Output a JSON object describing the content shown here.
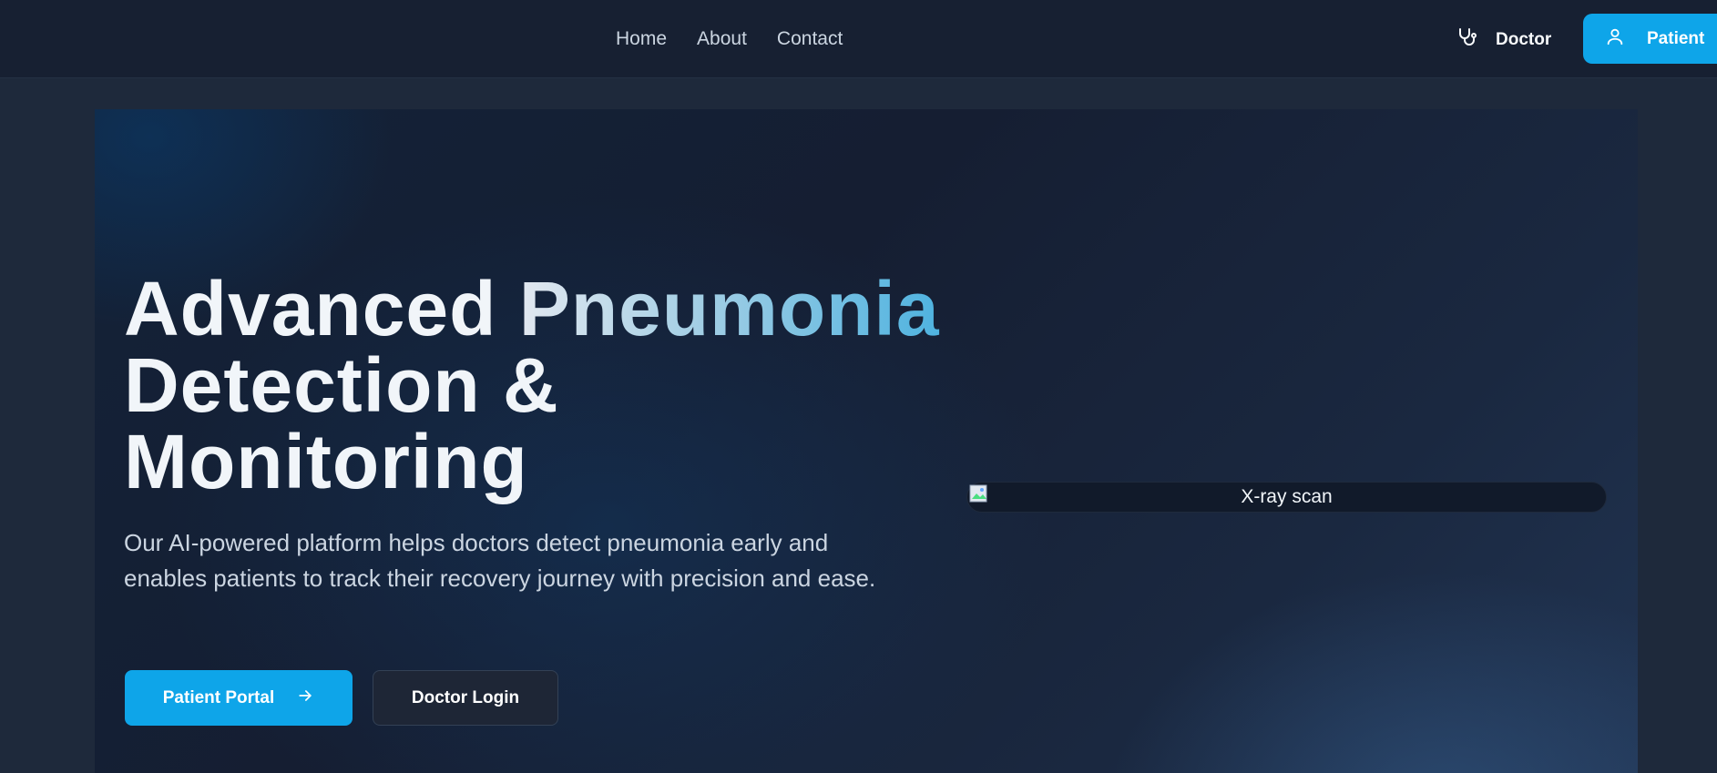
{
  "nav": {
    "links": [
      "Home",
      "About",
      "Contact"
    ],
    "doctor_label": "Doctor",
    "patient_label": "Patient"
  },
  "hero": {
    "headline_line1_plain": "Advanced ",
    "headline_line1_gradient": "Pneumonia",
    "headline_line2": "Detection &",
    "headline_line3": "Monitoring",
    "subtext": "Our AI-powered platform helps doctors detect pneumonia early and enables patients to track their recovery journey with precision and ease.",
    "primary_button": "Patient Portal",
    "secondary_button": "Doctor Login",
    "image_alt": "X-ray scan"
  },
  "icons": {
    "doctor": "stethoscope-icon",
    "patient": "user-icon",
    "primary_button": "arrow-right-icon",
    "image": "broken-image-icon"
  },
  "colors": {
    "accent": "#0ea5e9",
    "background": "#1e293b",
    "navbar": "#172032"
  }
}
